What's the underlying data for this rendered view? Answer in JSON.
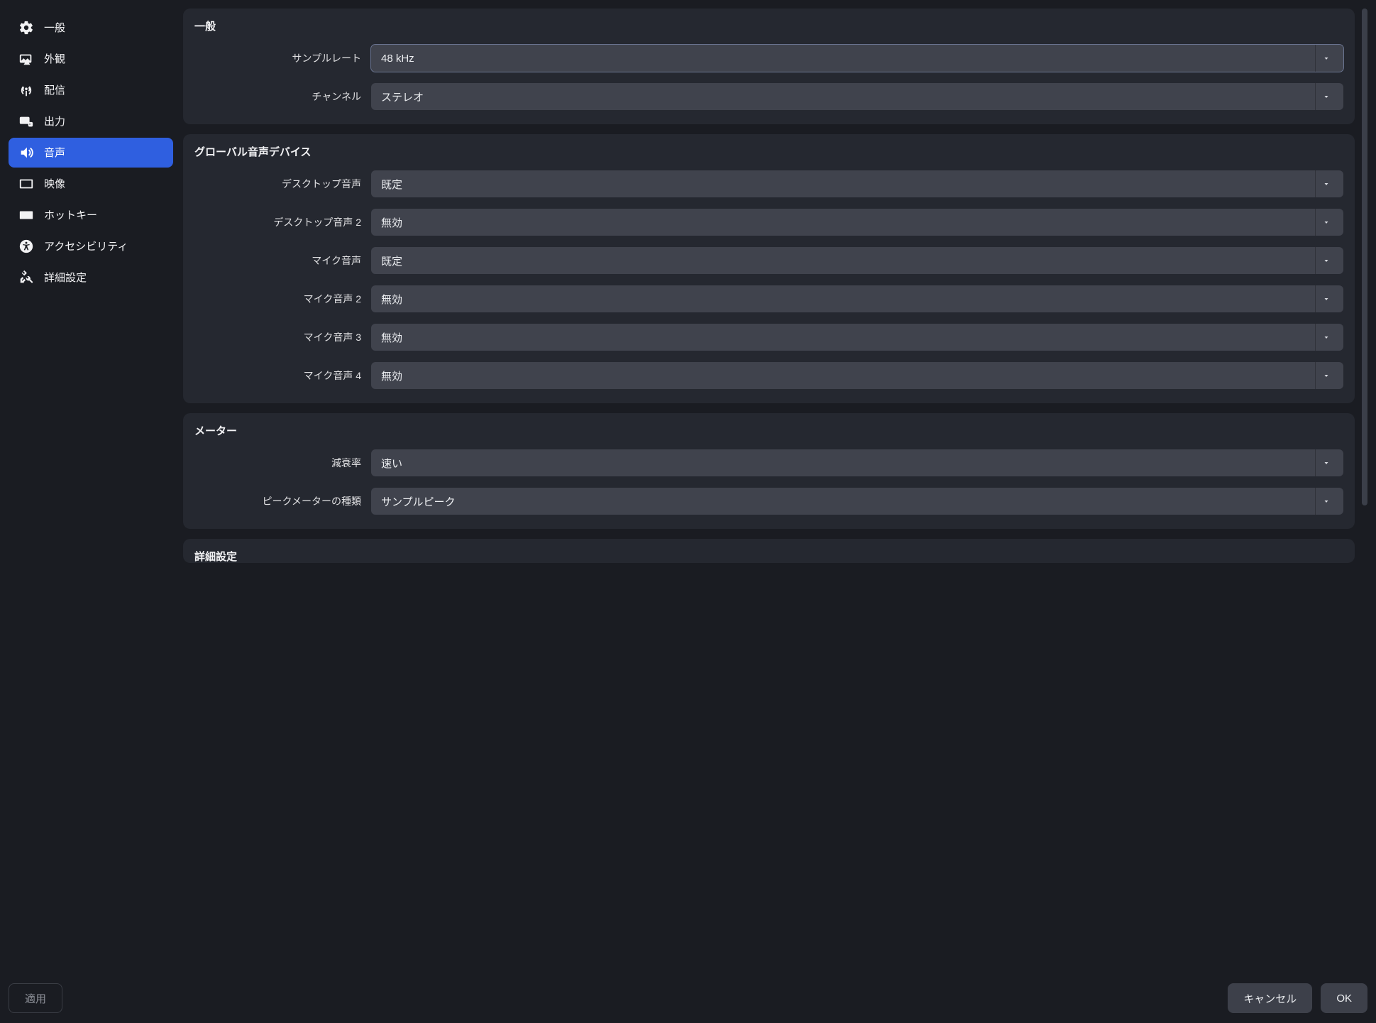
{
  "sidebar": {
    "items": [
      {
        "id": "general",
        "label": "一般"
      },
      {
        "id": "appearance",
        "label": "外観"
      },
      {
        "id": "stream",
        "label": "配信"
      },
      {
        "id": "output",
        "label": "出力"
      },
      {
        "id": "audio",
        "label": "音声"
      },
      {
        "id": "video",
        "label": "映像"
      },
      {
        "id": "hotkeys",
        "label": "ホットキー"
      },
      {
        "id": "accessibility",
        "label": "アクセシビリティ"
      },
      {
        "id": "advanced",
        "label": "詳細設定"
      }
    ],
    "active": "audio"
  },
  "sections": {
    "general": {
      "title": "一般",
      "sample_rate": {
        "label": "サンプルレート",
        "value": "48 kHz"
      },
      "channels": {
        "label": "チャンネル",
        "value": "ステレオ"
      }
    },
    "global_devices": {
      "title": "グローバル音声デバイス",
      "desktop1": {
        "label": "デスクトップ音声",
        "value": "既定"
      },
      "desktop2": {
        "label": "デスクトップ音声 2",
        "value": "無効"
      },
      "mic1": {
        "label": "マイク音声",
        "value": "既定"
      },
      "mic2": {
        "label": "マイク音声 2",
        "value": "無効"
      },
      "mic3": {
        "label": "マイク音声 3",
        "value": "無効"
      },
      "mic4": {
        "label": "マイク音声 4",
        "value": "無効"
      }
    },
    "meters": {
      "title": "メーター",
      "decay": {
        "label": "減衰率",
        "value": "速い"
      },
      "peak_meter": {
        "label": "ピークメーターの種類",
        "value": "サンプルピーク"
      }
    },
    "advanced": {
      "title": "詳細設定"
    }
  },
  "footer": {
    "apply": "適用",
    "cancel": "キャンセル",
    "ok": "OK"
  }
}
